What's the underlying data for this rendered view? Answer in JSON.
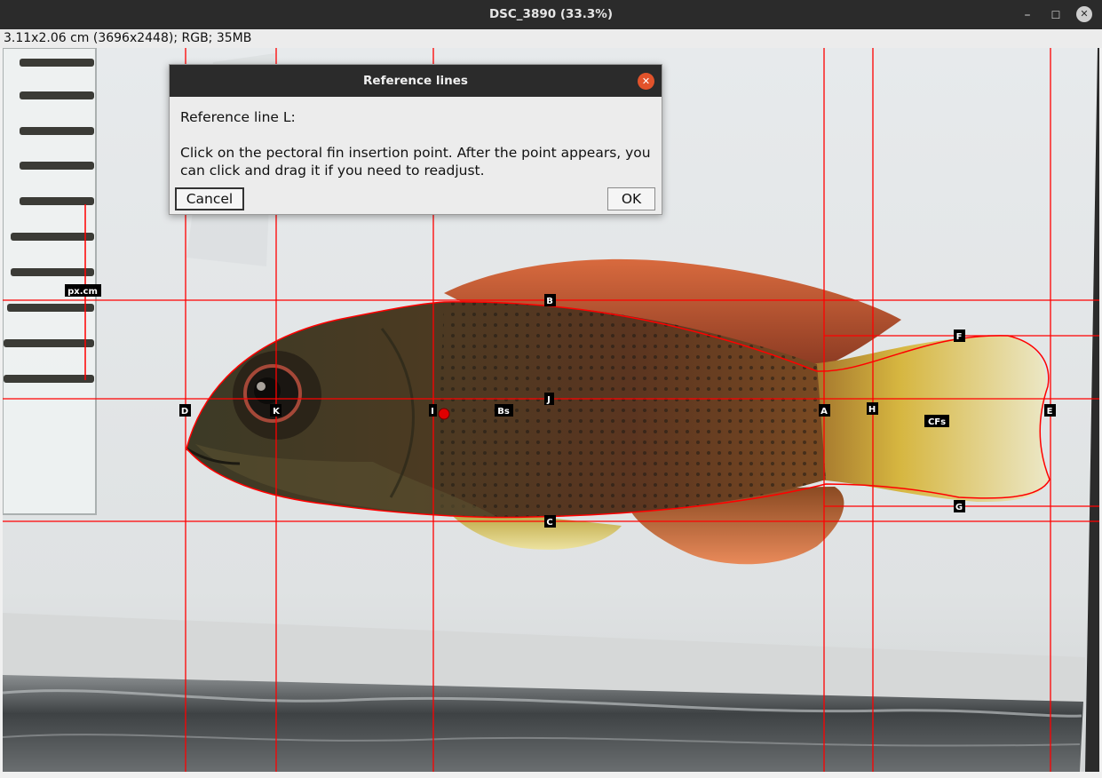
{
  "window": {
    "title": "DSC_3890 (33.3%)",
    "minimize_glyph": "–",
    "maximize_glyph": "☐",
    "close_glyph": "✕"
  },
  "infobar": {
    "text": "3.11x2.06 cm (3696x2448); RGB; 35MB"
  },
  "dialog": {
    "title": "Reference lines",
    "close_glyph": "✕",
    "heading": "Reference line L:",
    "message": "Click on the pectoral fin insertion point. After the point appears, you can click and drag it if you need to readjust.",
    "cancel_label": "Cancel",
    "ok_label": "OK"
  },
  "image": {
    "scale_label": "px.cm",
    "markers": [
      "B",
      "C",
      "D",
      "K",
      "I",
      "Bs",
      "J",
      "A",
      "H",
      "F",
      "CFs",
      "E",
      "G"
    ],
    "line_color": "#ff0000",
    "point_color": "#e00000"
  }
}
